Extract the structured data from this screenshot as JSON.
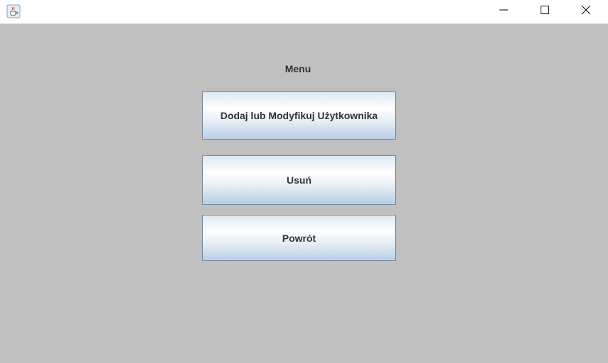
{
  "window": {
    "icon": "java-cup-icon",
    "controls": {
      "minimize": "minimize-icon",
      "maximize": "maximize-icon",
      "close": "close-icon"
    }
  },
  "menu": {
    "label": "Menu",
    "buttons": [
      {
        "label": "Dodaj lub Modyfikuj Użytkownika"
      },
      {
        "label": "Usuń"
      },
      {
        "label": "Powrót"
      }
    ]
  },
  "colors": {
    "background": "#c0c0c0",
    "titlebar": "#ffffff",
    "button_border": "#7a8a9e",
    "text": "#333333"
  }
}
